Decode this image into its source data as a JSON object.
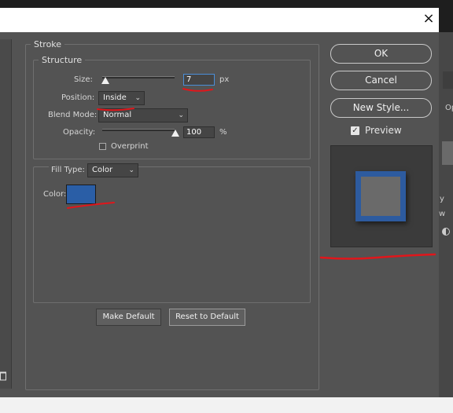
{
  "window": {
    "close_glyph": "×"
  },
  "stroke": {
    "title": "Stroke",
    "structure": {
      "title": "Structure",
      "size_label": "Size:",
      "size_value": "7",
      "size_unit": "px",
      "position_label": "Position:",
      "position_value": "Inside",
      "blend_label": "Blend Mode:",
      "blend_value": "Normal",
      "opacity_label": "Opacity:",
      "opacity_value": "100",
      "opacity_unit": "%",
      "overprint_label": "Overprint",
      "overprint_checked": false
    },
    "fill": {
      "type_label": "Fill Type:",
      "type_value": "Color",
      "color_label": "Color:",
      "color_hex": "#2a5ea6"
    },
    "make_default": "Make Default",
    "reset_default": "Reset to Default"
  },
  "buttons": {
    "ok": "OK",
    "cancel": "Cancel",
    "new_style": "New Style..."
  },
  "preview": {
    "label": "Preview",
    "checked": true
  },
  "background_right": {
    "texts": [
      "Op",
      "y",
      "w"
    ]
  },
  "annotation_color": "#e0161b"
}
